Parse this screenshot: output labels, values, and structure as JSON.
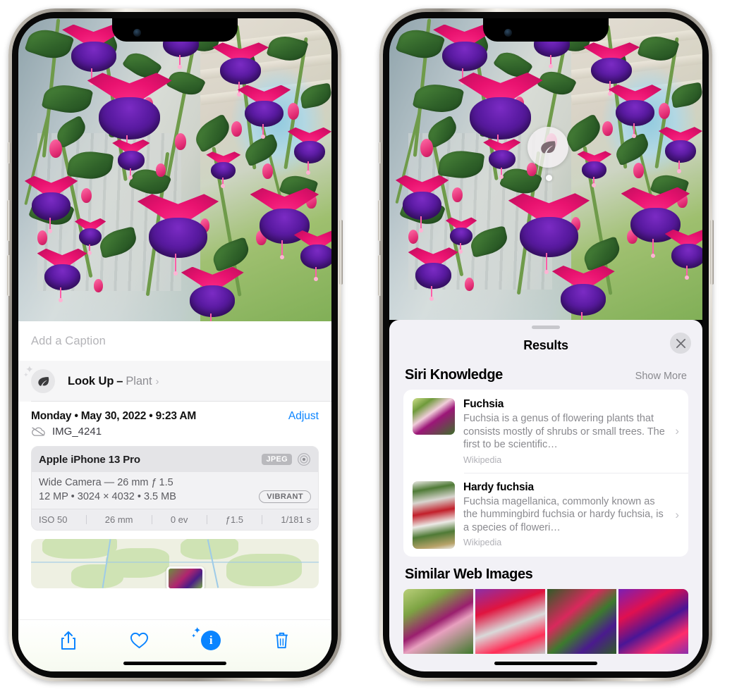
{
  "left_phone": {
    "photo": {
      "alt": "fuchsia-flowers-photo"
    },
    "caption_field": {
      "placeholder": "Add a Caption",
      "value": ""
    },
    "look_up": {
      "label": "Look Up",
      "dash": "–",
      "subject": "Plant",
      "chevron": "›",
      "icon": "leaf-icon",
      "sparkle": "✦"
    },
    "info": {
      "date_line": "Monday • May 30, 2022 • 9:23 AM",
      "adjust_label": "Adjust",
      "filename": "IMG_4241",
      "cloud_icon": "icloud-slash-icon"
    },
    "metadata_card": {
      "device": "Apple iPhone 13 Pro",
      "format_badge": "JPEG",
      "raw_icon": "aperture-icon",
      "lens_line": "Wide Camera — 26 mm ƒ 1.5",
      "size_line": "12 MP • 3024 × 4032 • 3.5 MB",
      "style_badge": "VIBRANT",
      "exif": [
        "ISO 50",
        "26 mm",
        "0 ev",
        "ƒ1.5",
        "1/181 s"
      ]
    },
    "map": {
      "name": "location-map-thumbnail"
    },
    "toolbar": [
      {
        "name": "share-button",
        "icon": "share-icon"
      },
      {
        "name": "favorite-button",
        "icon": "heart-icon"
      },
      {
        "name": "info-button",
        "icon": "info-sparkle-icon",
        "glyph": "i"
      },
      {
        "name": "delete-button",
        "icon": "trash-icon"
      }
    ]
  },
  "right_phone": {
    "visual_lookup_badge": {
      "icon": "leaf-icon"
    },
    "sheet": {
      "title": "Results",
      "close_icon": "close-icon",
      "grabber": "drag-handle"
    },
    "siri_knowledge": {
      "heading": "Siri Knowledge",
      "show_more": "Show More",
      "items": [
        {
          "title": "Fuchsia",
          "description": "Fuchsia is a genus of flowering plants that consists mostly of shrubs or small trees. The first to be scientific…",
          "source": "Wikipedia",
          "chevron": "›",
          "thumb": "fuchsia-thumb"
        },
        {
          "title": "Hardy fuchsia",
          "description": "Fuchsia magellanica, commonly known as the hummingbird fuchsia or hardy fuchsia, is a species of floweri…",
          "source": "Wikipedia",
          "chevron": "›",
          "thumb": "hardy-fuchsia-thumb"
        }
      ]
    },
    "similar_web_images": {
      "heading": "Similar Web Images",
      "thumbs": [
        "web-image-1",
        "web-image-2",
        "web-image-3",
        "web-image-4"
      ]
    }
  },
  "colors": {
    "accent_blue": "#0a84ff",
    "sheet_bg": "#f2f1f6",
    "secondary_text": "#8a8a8f",
    "card_bg": "#ffffff"
  }
}
